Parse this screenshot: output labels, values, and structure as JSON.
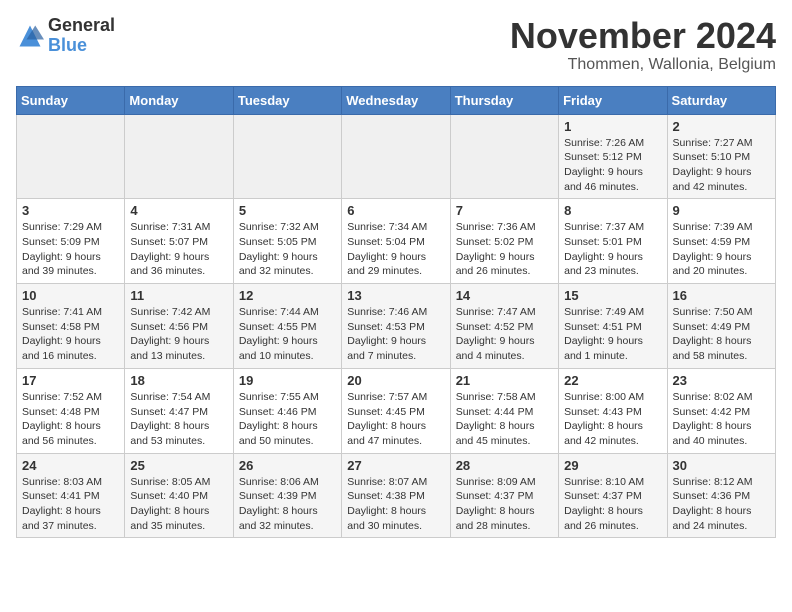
{
  "logo": {
    "general": "General",
    "blue": "Blue"
  },
  "title": "November 2024",
  "subtitle": "Thommen, Wallonia, Belgium",
  "days_header": [
    "Sunday",
    "Monday",
    "Tuesday",
    "Wednesday",
    "Thursday",
    "Friday",
    "Saturday"
  ],
  "weeks": [
    [
      {
        "day": "",
        "info": ""
      },
      {
        "day": "",
        "info": ""
      },
      {
        "day": "",
        "info": ""
      },
      {
        "day": "",
        "info": ""
      },
      {
        "day": "",
        "info": ""
      },
      {
        "day": "1",
        "info": "Sunrise: 7:26 AM\nSunset: 5:12 PM\nDaylight: 9 hours and 46 minutes."
      },
      {
        "day": "2",
        "info": "Sunrise: 7:27 AM\nSunset: 5:10 PM\nDaylight: 9 hours and 42 minutes."
      }
    ],
    [
      {
        "day": "3",
        "info": "Sunrise: 7:29 AM\nSunset: 5:09 PM\nDaylight: 9 hours and 39 minutes."
      },
      {
        "day": "4",
        "info": "Sunrise: 7:31 AM\nSunset: 5:07 PM\nDaylight: 9 hours and 36 minutes."
      },
      {
        "day": "5",
        "info": "Sunrise: 7:32 AM\nSunset: 5:05 PM\nDaylight: 9 hours and 32 minutes."
      },
      {
        "day": "6",
        "info": "Sunrise: 7:34 AM\nSunset: 5:04 PM\nDaylight: 9 hours and 29 minutes."
      },
      {
        "day": "7",
        "info": "Sunrise: 7:36 AM\nSunset: 5:02 PM\nDaylight: 9 hours and 26 minutes."
      },
      {
        "day": "8",
        "info": "Sunrise: 7:37 AM\nSunset: 5:01 PM\nDaylight: 9 hours and 23 minutes."
      },
      {
        "day": "9",
        "info": "Sunrise: 7:39 AM\nSunset: 4:59 PM\nDaylight: 9 hours and 20 minutes."
      }
    ],
    [
      {
        "day": "10",
        "info": "Sunrise: 7:41 AM\nSunset: 4:58 PM\nDaylight: 9 hours and 16 minutes."
      },
      {
        "day": "11",
        "info": "Sunrise: 7:42 AM\nSunset: 4:56 PM\nDaylight: 9 hours and 13 minutes."
      },
      {
        "day": "12",
        "info": "Sunrise: 7:44 AM\nSunset: 4:55 PM\nDaylight: 9 hours and 10 minutes."
      },
      {
        "day": "13",
        "info": "Sunrise: 7:46 AM\nSunset: 4:53 PM\nDaylight: 9 hours and 7 minutes."
      },
      {
        "day": "14",
        "info": "Sunrise: 7:47 AM\nSunset: 4:52 PM\nDaylight: 9 hours and 4 minutes."
      },
      {
        "day": "15",
        "info": "Sunrise: 7:49 AM\nSunset: 4:51 PM\nDaylight: 9 hours and 1 minute."
      },
      {
        "day": "16",
        "info": "Sunrise: 7:50 AM\nSunset: 4:49 PM\nDaylight: 8 hours and 58 minutes."
      }
    ],
    [
      {
        "day": "17",
        "info": "Sunrise: 7:52 AM\nSunset: 4:48 PM\nDaylight: 8 hours and 56 minutes."
      },
      {
        "day": "18",
        "info": "Sunrise: 7:54 AM\nSunset: 4:47 PM\nDaylight: 8 hours and 53 minutes."
      },
      {
        "day": "19",
        "info": "Sunrise: 7:55 AM\nSunset: 4:46 PM\nDaylight: 8 hours and 50 minutes."
      },
      {
        "day": "20",
        "info": "Sunrise: 7:57 AM\nSunset: 4:45 PM\nDaylight: 8 hours and 47 minutes."
      },
      {
        "day": "21",
        "info": "Sunrise: 7:58 AM\nSunset: 4:44 PM\nDaylight: 8 hours and 45 minutes."
      },
      {
        "day": "22",
        "info": "Sunrise: 8:00 AM\nSunset: 4:43 PM\nDaylight: 8 hours and 42 minutes."
      },
      {
        "day": "23",
        "info": "Sunrise: 8:02 AM\nSunset: 4:42 PM\nDaylight: 8 hours and 40 minutes."
      }
    ],
    [
      {
        "day": "24",
        "info": "Sunrise: 8:03 AM\nSunset: 4:41 PM\nDaylight: 8 hours and 37 minutes."
      },
      {
        "day": "25",
        "info": "Sunrise: 8:05 AM\nSunset: 4:40 PM\nDaylight: 8 hours and 35 minutes."
      },
      {
        "day": "26",
        "info": "Sunrise: 8:06 AM\nSunset: 4:39 PM\nDaylight: 8 hours and 32 minutes."
      },
      {
        "day": "27",
        "info": "Sunrise: 8:07 AM\nSunset: 4:38 PM\nDaylight: 8 hours and 30 minutes."
      },
      {
        "day": "28",
        "info": "Sunrise: 8:09 AM\nSunset: 4:37 PM\nDaylight: 8 hours and 28 minutes."
      },
      {
        "day": "29",
        "info": "Sunrise: 8:10 AM\nSunset: 4:37 PM\nDaylight: 8 hours and 26 minutes."
      },
      {
        "day": "30",
        "info": "Sunrise: 8:12 AM\nSunset: 4:36 PM\nDaylight: 8 hours and 24 minutes."
      }
    ]
  ]
}
